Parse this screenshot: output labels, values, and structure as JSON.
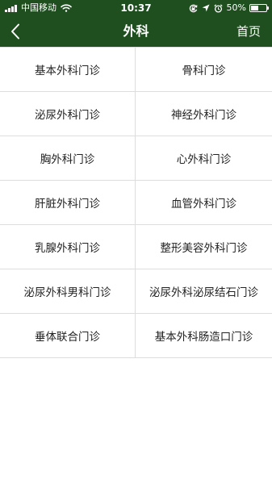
{
  "status_bar": {
    "carrier": "中国移动",
    "time": "10:37",
    "battery_percent": "50%",
    "battery_level": 0.5,
    "icons": [
      "signal-icon",
      "wifi-icon",
      "screen-lock-icon",
      "location-icon",
      "alarm-icon",
      "battery-icon"
    ]
  },
  "nav": {
    "title": "外科",
    "home_label": "首页",
    "back_icon": "back-chevron-icon"
  },
  "colors": {
    "header_bg": "#1f4f1f",
    "header_text": "#ffffff",
    "divider": "#dddddd",
    "cell_text": "#222222"
  },
  "clinics": [
    "基本外科门诊",
    "骨科门诊",
    "泌尿外科门诊",
    "神经外科门诊",
    "胸外科门诊",
    "心外科门诊",
    "肝脏外科门诊",
    "血管外科门诊",
    "乳腺外科门诊",
    "整形美容外科门诊",
    "泌尿外科男科门诊",
    "泌尿外科泌尿结石门诊",
    "垂体联合门诊",
    "基本外科肠造口门诊"
  ]
}
